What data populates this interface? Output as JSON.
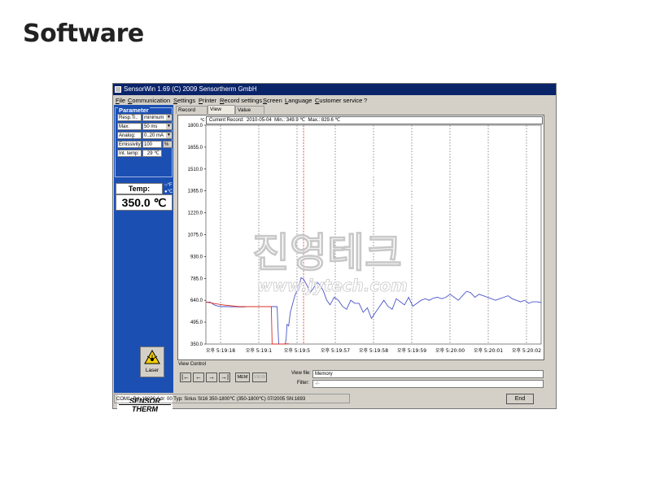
{
  "slide": {
    "title": "Software"
  },
  "window": {
    "title": "SensorWin 1.69 (C) 2009 Sensortherm GmbH",
    "menu": [
      "File",
      "Communication",
      "Settings",
      "Printer",
      "Record settings",
      "Screen",
      "Language",
      "Customer service",
      "?"
    ]
  },
  "params": {
    "title": "Parameter",
    "rows": [
      {
        "label": "Resp.Ti.:",
        "value": "minimum",
        "dropdown": true
      },
      {
        "label": "Max:",
        "value": "50 ms",
        "dropdown": true
      },
      {
        "label": "Analog:",
        "value": "0..20 mA",
        "dropdown": true
      },
      {
        "label": "Emissivity",
        "value": "100",
        "unit": "%"
      },
      {
        "label": "Int. temp:",
        "value": "29 ℃"
      }
    ]
  },
  "temp": {
    "label": "Temp:",
    "value": "350.0 ℃",
    "unit_options": [
      "°F",
      "°C"
    ]
  },
  "laser": {
    "label": "Laser"
  },
  "logo": {
    "line1": "SENSOR",
    "line2": "THERM"
  },
  "tabs": [
    "Record Table",
    "View Table",
    "Value Table"
  ],
  "active_tab": 1,
  "header": {
    "unit": "℃",
    "label": "Current Record:",
    "date": "2010-05-04",
    "min": "Min.: 349.9 ℃",
    "max": "Max.: 829.6 ℃"
  },
  "view_control": {
    "title": "View Control",
    "buttons": [
      "|←",
      "←",
      "→",
      "→|",
      "MEM",
      "VIEW"
    ],
    "view_file_label": "View file:",
    "view_file_value": "Memory",
    "filter_label": "Filter:",
    "filter_value": "-/-"
  },
  "status": "COM1: Bd: 19200 Adr: 00 Typ: Sirius SI16 350-1800℃ (350-1800℃) 07/2005 SN:1693",
  "end_label": "End",
  "watermark": {
    "text": "진영테크",
    "url": "www.jytech.com"
  },
  "chart_data": {
    "type": "line",
    "y_ticks": [
      "1800.0",
      "1655.0",
      "1510.0",
      "1365.0",
      "1220.0",
      "1075.0",
      "930.0",
      "785.0",
      "640.0",
      "495.0",
      "350.0"
    ],
    "ylim": [
      350,
      1800
    ],
    "x_ticks": [
      "오후 5:19:18",
      "오후 5:19:1",
      "오후 5:19:5",
      "오후 5:19:57",
      "오후 5:19:58",
      "오후 5:19:59",
      "오후 5:20:00",
      "오후 5:20:01",
      "오후 5:20:02"
    ],
    "grid": true,
    "series": [
      {
        "color": "#4a55c8",
        "x": [
          0,
          5,
          10,
          15,
          20,
          25,
          30,
          35,
          40,
          45,
          50,
          55,
          60,
          65,
          70,
          75,
          80,
          82,
          84,
          86,
          88,
          90,
          92,
          94,
          96,
          97,
          98,
          100,
          102,
          105,
          108,
          112,
          115,
          118,
          122,
          126,
          130,
          134,
          138,
          142,
          146,
          150,
          155,
          160,
          165,
          170,
          175,
          180,
          185,
          190,
          195,
          200,
          205,
          210,
          215,
          220,
          225,
          230,
          235,
          240,
          245,
          250,
          255,
          260,
          265,
          270,
          275,
          280,
          285,
          290,
          295,
          300,
          305,
          310,
          315,
          320,
          325,
          330,
          335,
          340,
          345,
          350,
          355,
          360,
          365,
          370,
          375,
          380,
          385,
          390,
          395,
          400,
          405
        ],
        "y": [
          628,
          628,
          610,
          600,
          598,
          598,
          597,
          597,
          596,
          596,
          598,
          598,
          598,
          598,
          598,
          598,
          598,
          598,
          598,
          598,
          350,
          350,
          350,
          350,
          352,
          390,
          480,
          470,
          560,
          620,
          680,
          720,
          790,
          780,
          740,
          690,
          720,
          760,
          740,
          700,
          640,
          610,
          660,
          640,
          600,
          580,
          640,
          620,
          620,
          560,
          590,
          520,
          560,
          600,
          640,
          600,
          580,
          650,
          630,
          610,
          660,
          600,
          620,
          640,
          650,
          640,
          655,
          660,
          650,
          660,
          680,
          660,
          640,
          670,
          700,
          690,
          660,
          680,
          670,
          660,
          650,
          640,
          650,
          660,
          670,
          650,
          640,
          630,
          640,
          620,
          630,
          630,
          625
        ]
      },
      {
        "color": "#d83020",
        "x": [
          0,
          20,
          40,
          60,
          75,
          79,
          80,
          82,
          90,
          95,
          100
        ],
        "y": [
          628,
          610,
          598,
          598,
          598,
          598,
          350,
          350,
          350,
          350,
          352
        ]
      }
    ],
    "x_range": [
      0,
      405
    ],
    "markers": [
      {
        "x": 118,
        "color": "#d83020",
        "style": "dashed"
      }
    ]
  }
}
